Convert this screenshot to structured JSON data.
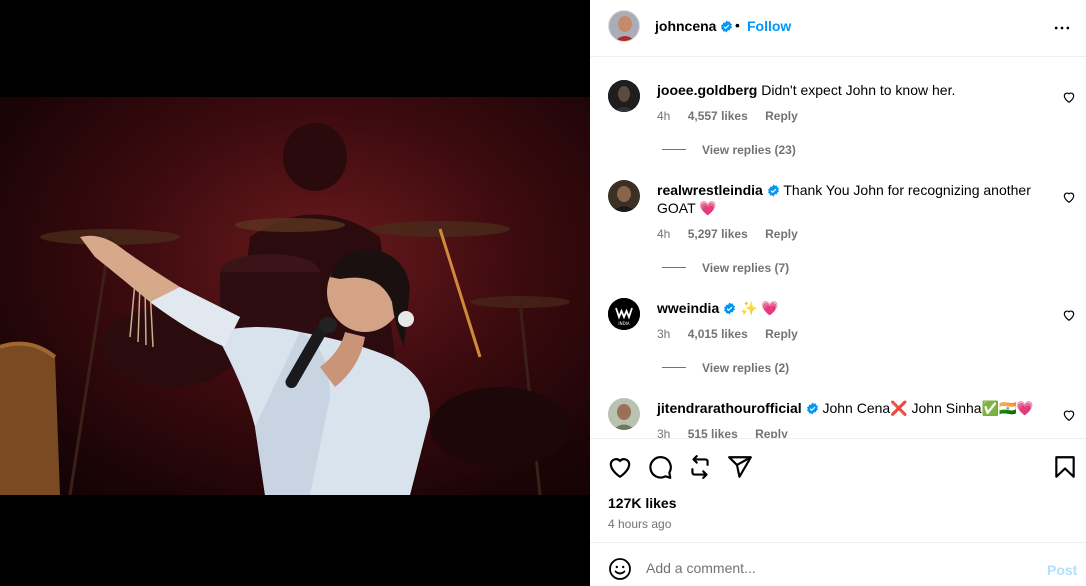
{
  "header": {
    "username": "johncena",
    "separator": "•",
    "follow_label": "Follow"
  },
  "comments": [
    {
      "username": "jooee.goldberg",
      "verified": false,
      "text": "Didn't expect John to know her.",
      "time": "4h",
      "likes": "4,557 likes",
      "reply_label": "Reply",
      "view_replies": "View replies (23)"
    },
    {
      "username": "realwrestleindia",
      "verified": true,
      "text": "Thank You John for recognizing another GOAT 💗",
      "time": "4h",
      "likes": "5,297 likes",
      "reply_label": "Reply",
      "view_replies": "View replies (7)"
    },
    {
      "username": "wweindia",
      "verified": true,
      "text": "✨ 💗",
      "time": "3h",
      "likes": "4,015 likes",
      "reply_label": "Reply",
      "view_replies": "View replies (2)"
    },
    {
      "username": "jitendrarathourofficial",
      "verified": true,
      "text": "John Cena❌ John Sinha✅🇮🇳💗",
      "time": "3h",
      "likes": "515 likes",
      "reply_label": "Reply"
    }
  ],
  "avatar_labels": {
    "wweindia": "INDIA"
  },
  "footer": {
    "likes": "127K likes",
    "time_ago": "4 hours ago"
  },
  "add_comment": {
    "placeholder": "Add a comment...",
    "post_label": "Post"
  },
  "colors": {
    "accent": "#0095f6",
    "verified": "#0095f6",
    "post_disabled": "#b2dffc",
    "muted": "#737373"
  },
  "icons": [
    "more-options-icon",
    "heart-icon",
    "comment-icon",
    "repost-icon",
    "share-icon",
    "bookmark-icon",
    "emoji-icon",
    "verified-badge-icon"
  ]
}
